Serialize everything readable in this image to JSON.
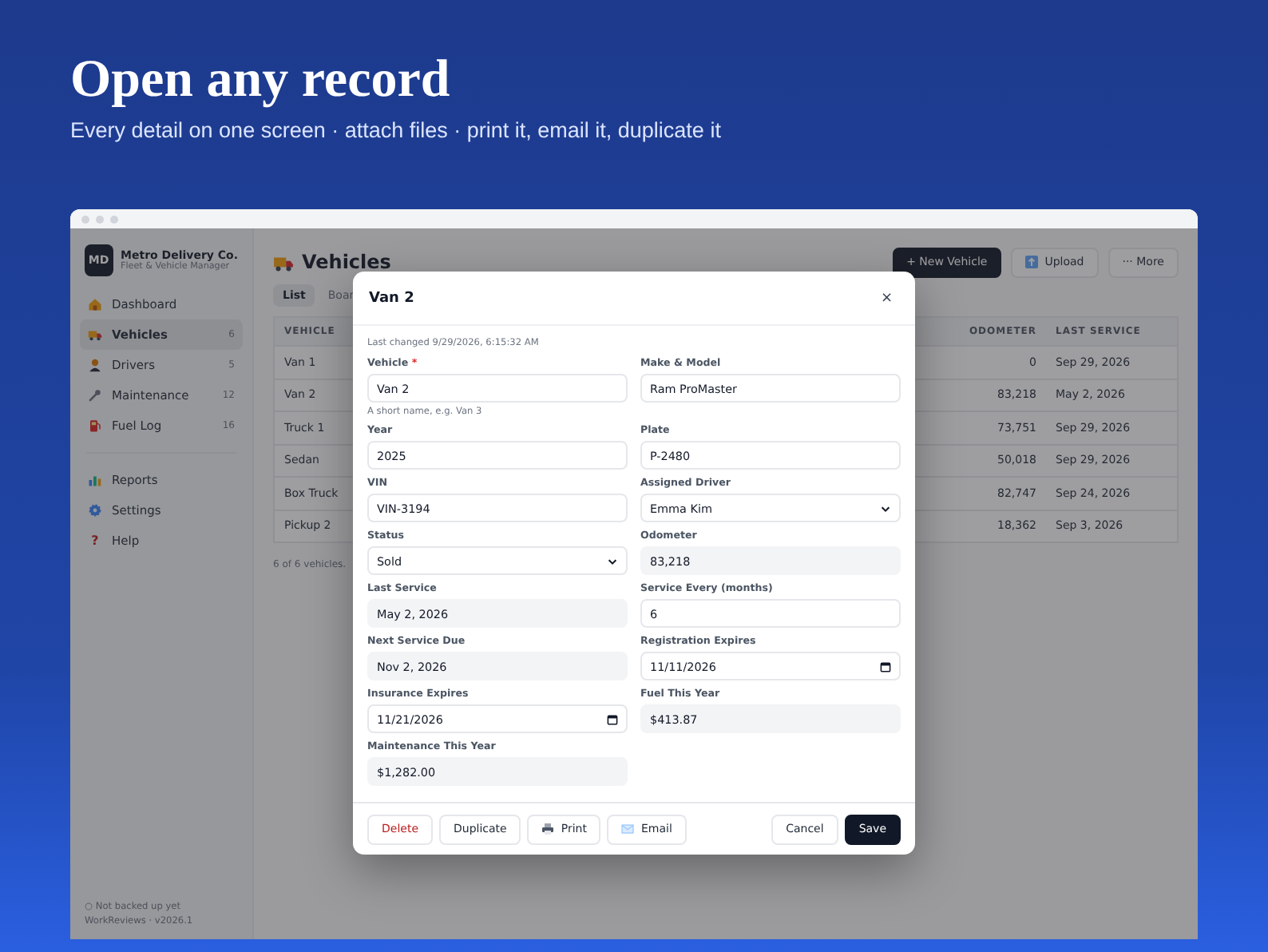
{
  "hero": {
    "title": "Open any record",
    "subtitle": "Every detail on one screen · attach files · print it, email it, duplicate it"
  },
  "sidebar": {
    "brand": {
      "initials": "MD",
      "name": "Metro Delivery Co.",
      "tagline": "Fleet & Vehicle Manager"
    },
    "groups": [
      [
        {
          "label": "Dashboard",
          "selected": false
        },
        {
          "label": "Vehicles",
          "count": "6",
          "selected": true
        },
        {
          "label": "Drivers",
          "count": "5",
          "selected": false
        },
        {
          "label": "Maintenance",
          "count": "12",
          "selected": false
        },
        {
          "label": "Fuel Log",
          "count": "16",
          "selected": false
        }
      ],
      [
        {
          "label": "Reports",
          "selected": false
        },
        {
          "label": "Settings",
          "selected": false
        },
        {
          "label": "Help",
          "selected": false,
          "glyph": "?"
        }
      ]
    ],
    "backup_status": "○ Not backed up yet",
    "version": "WorkReviews · v2026.1"
  },
  "main": {
    "title": "Vehicles",
    "buttons": [
      {
        "label": "+ New Vehicle",
        "kind": "primary"
      },
      {
        "label": "Upload",
        "kind": "upload"
      },
      {
        "label": "··· More",
        "kind": "plain"
      }
    ],
    "tabs": [
      {
        "label": "List",
        "selected": true
      },
      {
        "label": "Boar",
        "selected": false
      }
    ],
    "table": {
      "columns": [
        "VEHICLE",
        "ODOMETER",
        "LAST SERVICE"
      ],
      "rows": [
        [
          "Van 1",
          "0",
          "Sep 29, 2026"
        ],
        [
          "Van 2",
          "83,218",
          "May 2, 2026"
        ],
        [
          "Truck 1",
          "73,751",
          "Sep 29, 2026"
        ],
        [
          "Sedan",
          "50,018",
          "Sep 29, 2026"
        ],
        [
          "Box Truck",
          "82,747",
          "Sep 24, 2026"
        ],
        [
          "Pickup 2",
          "18,362",
          "Sep 3, 2026"
        ]
      ]
    },
    "footer_text": "6 of 6 vehicles."
  },
  "dialog": {
    "title": "Van 2",
    "close": "×",
    "last_changed": "Last changed 9/29/2026, 6:15:32 AM",
    "fields": [
      {
        "label": "Vehicle",
        "required_mark": "*",
        "kind": "text",
        "value": "Van 2",
        "hint": "A short name, e.g. Van 3"
      },
      {
        "label": "Make & Model",
        "kind": "text",
        "value": "Ram ProMaster"
      },
      {
        "label": "Year",
        "kind": "text",
        "value": "2025"
      },
      {
        "label": "Plate",
        "kind": "text",
        "value": "P-2480"
      },
      {
        "label": "VIN",
        "kind": "text",
        "value": "VIN-3194"
      },
      {
        "label": "Assigned Driver",
        "kind": "select",
        "value": "Emma Kim"
      },
      {
        "label": "Status",
        "kind": "select",
        "value": "Sold"
      },
      {
        "label": "Odometer",
        "kind": "readonly",
        "value": "83,218"
      },
      {
        "label": "Last Service",
        "kind": "readonly",
        "value": "May 2, 2026"
      },
      {
        "label": "Service Every (months)",
        "kind": "text",
        "value": "6"
      },
      {
        "label": "Next Service Due",
        "kind": "readonly",
        "value": "Nov 2, 2026"
      },
      {
        "label": "Registration Expires",
        "kind": "date",
        "value": "11/11/2026"
      },
      {
        "label": "Insurance Expires",
        "kind": "date",
        "value": "11/21/2026"
      },
      {
        "label": "Fuel This Year",
        "kind": "readonly",
        "value": "$413.87"
      },
      {
        "label": "Maintenance This Year",
        "kind": "readonly",
        "value": "$1,282.00"
      }
    ],
    "actions_left": [
      {
        "label": "Delete",
        "kind": "danger"
      },
      {
        "label": "Duplicate",
        "kind": "plain"
      },
      {
        "label": "Print",
        "kind": "print"
      },
      {
        "label": "Email",
        "kind": "email"
      }
    ],
    "actions_right": [
      {
        "label": "Cancel",
        "kind": "plain"
      },
      {
        "label": "Save",
        "kind": "primary"
      }
    ]
  }
}
